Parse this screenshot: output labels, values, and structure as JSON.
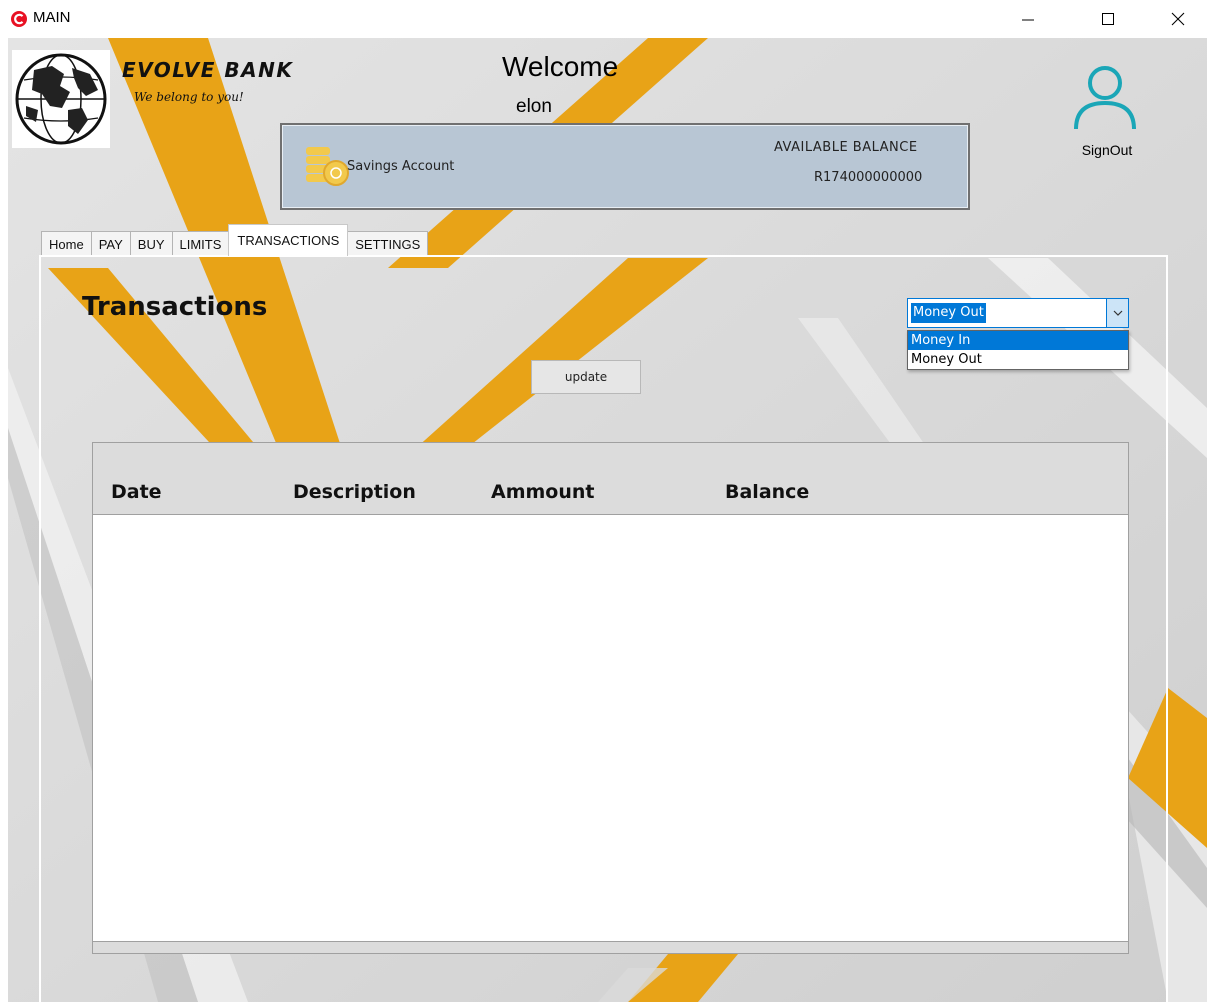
{
  "window": {
    "title": "MAIN"
  },
  "header": {
    "bank_name": "EVOLVE BANK",
    "tagline": "We belong to you!",
    "welcome": "Welcome",
    "username": "elon",
    "signout_label": "SignOut"
  },
  "account": {
    "type_label": "Savings Account",
    "balance_label": "AVAILABLE BALANCE",
    "balance_value": "R174000000000"
  },
  "tabs": [
    {
      "label": "Home"
    },
    {
      "label": "PAY"
    },
    {
      "label": "BUY"
    },
    {
      "label": "LIMITS"
    },
    {
      "label": "TRANSACTIONS",
      "active": true
    },
    {
      "label": "SETTINGS"
    }
  ],
  "transactions": {
    "title": "Transactions",
    "update_label": "update",
    "filter": {
      "selected": "Money Out",
      "options": [
        "Money In",
        "Money Out"
      ]
    },
    "columns": [
      "Date",
      "Description",
      "Ammount",
      "Balance"
    ],
    "rows": []
  },
  "colors": {
    "accent_orange": "#e8a317",
    "panel_blue": "#b8c6d4",
    "signout_teal": "#1aa6b7",
    "selection_blue": "#0078d7",
    "app_icon_red": "#e81123"
  }
}
